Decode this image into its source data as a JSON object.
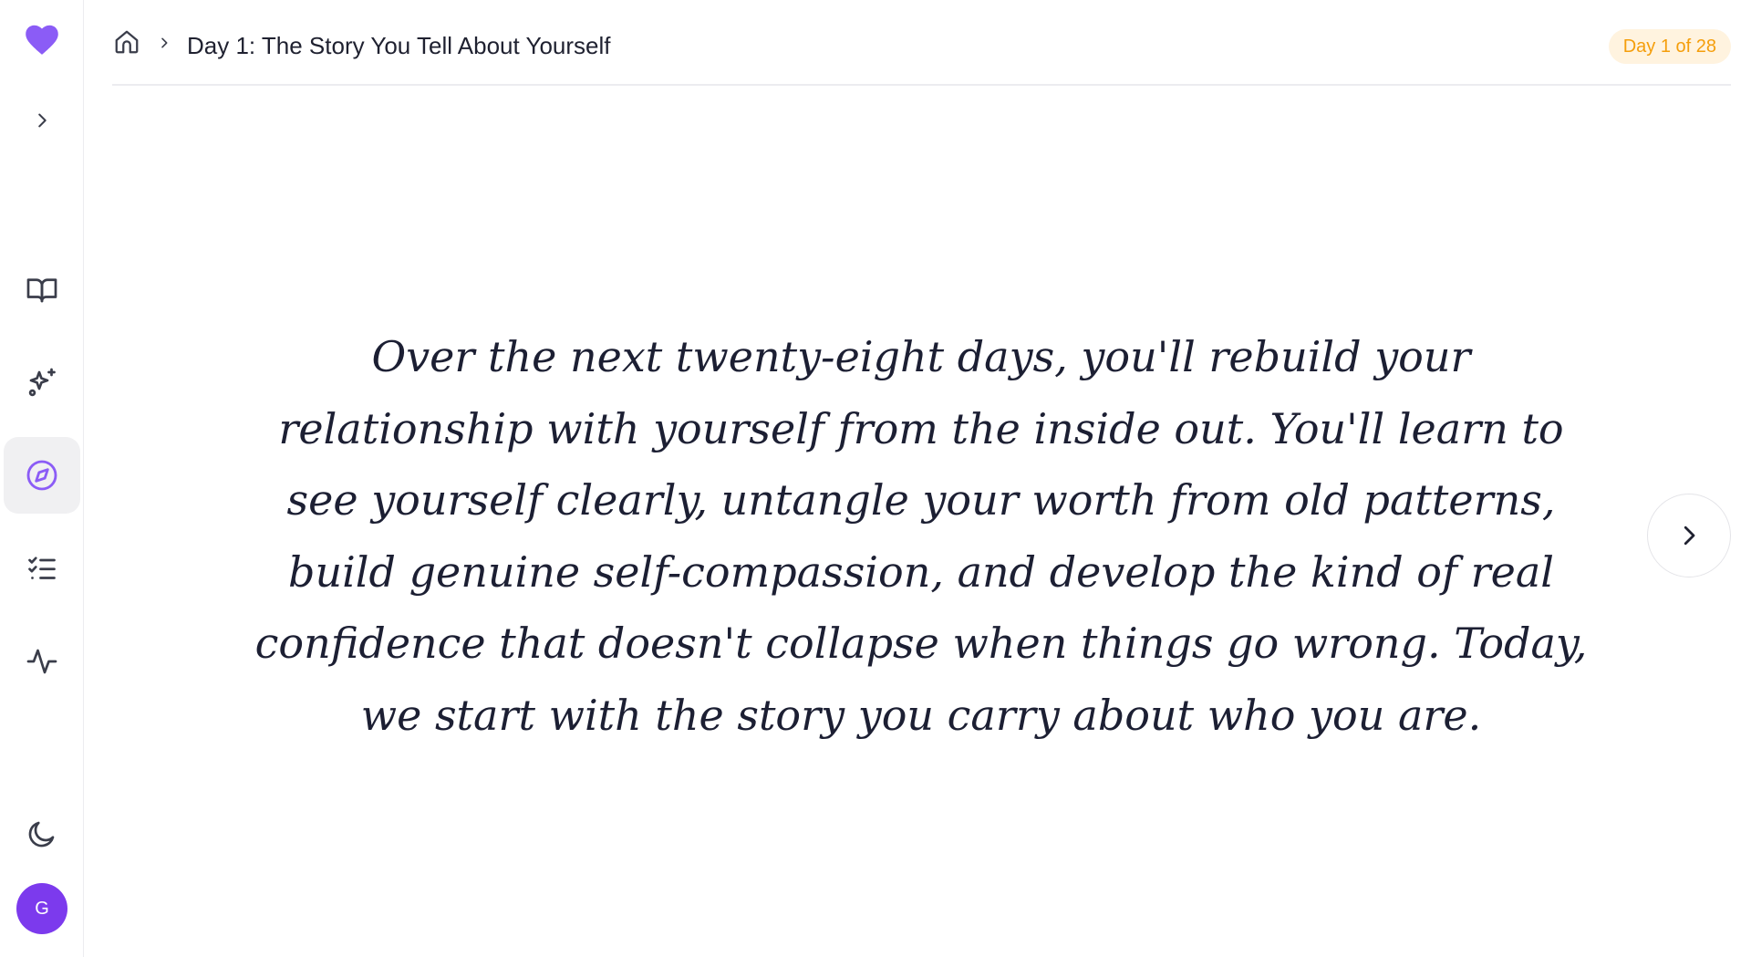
{
  "colors": {
    "brand": "#8b5cf6",
    "active_icon": "#8b5cf6",
    "icon": "#3a3d4a",
    "badge_bg": "#fff3df",
    "badge_text": "#f59e0b",
    "avatar_bg": "#7c3aed"
  },
  "sidebar": {
    "logo_icon": "heart-icon",
    "expand_icon": "chevron-right-icon",
    "items": [
      {
        "icon": "book-open-icon",
        "active": false
      },
      {
        "icon": "sparkles-icon",
        "active": false
      },
      {
        "icon": "compass-icon",
        "active": true
      },
      {
        "icon": "checklist-icon",
        "active": false
      },
      {
        "icon": "activity-icon",
        "active": false
      }
    ],
    "theme_icon": "moon-icon",
    "avatar_initial": "G"
  },
  "header": {
    "home_icon": "home-icon",
    "separator_icon": "chevron-right-icon",
    "title": "Day 1: The Story You Tell About Yourself",
    "badge": "Day 1 of 28"
  },
  "main": {
    "intro": "Over the next twenty-eight days, you'll rebuild your relationship with yourself from the inside out. You'll learn to see yourself clearly, untangle your worth from old patterns, build genuine self-compassion, and develop the kind of real confidence that doesn't collapse when things go wrong. Today, we start with the story you carry about who you are.",
    "next_icon": "chevron-right-icon"
  }
}
